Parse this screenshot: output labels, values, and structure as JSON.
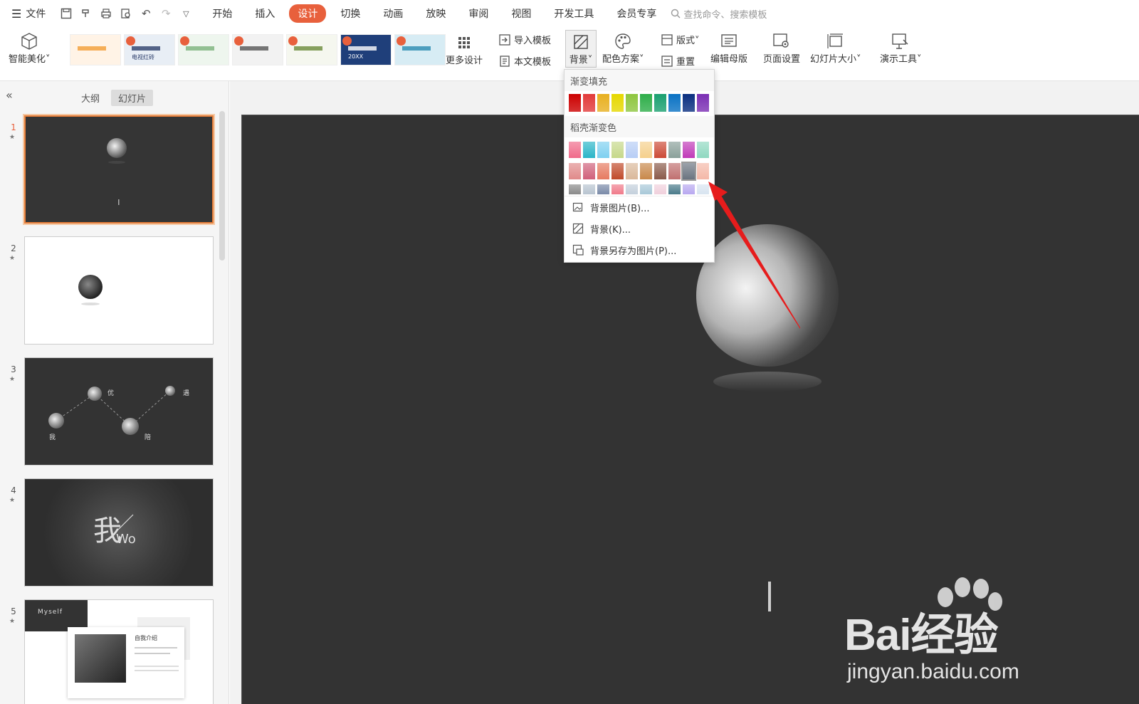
{
  "menubar": {
    "file_label": "文件",
    "tabs": [
      {
        "label": "开始",
        "active": false
      },
      {
        "label": "插入",
        "active": false
      },
      {
        "label": "设计",
        "active": true
      },
      {
        "label": "切换",
        "active": false
      },
      {
        "label": "动画",
        "active": false
      },
      {
        "label": "放映",
        "active": false
      },
      {
        "label": "审阅",
        "active": false
      },
      {
        "label": "视图",
        "active": false
      },
      {
        "label": "开发工具",
        "active": false
      },
      {
        "label": "会员专享",
        "active": false
      }
    ],
    "search_placeholder": "查找命令、搜索模板"
  },
  "ribbon": {
    "smart_beautify": "智能美化",
    "more_design": "更多设计",
    "import_template": "导入模板",
    "text_template": "本文模板",
    "background": "背景",
    "color_scheme": "配色方案",
    "layout": "版式",
    "reset": "重置",
    "edit_master": "编辑母版",
    "page_setup": "页面设置",
    "slide_size": "幻灯片大小",
    "presentation_tools": "演示工具",
    "template_thumbs": [
      {
        "text": "",
        "bg": "#fff3e6",
        "accent": "#f39c34"
      },
      {
        "text": "电视红砖",
        "bg": "#e8eef5",
        "accent": "#2c3e6b"
      },
      {
        "text": "",
        "bg": "#eef6ee",
        "accent": "#7bb37b"
      },
      {
        "text": "",
        "bg": "#f2f2f2",
        "accent": "#555555"
      },
      {
        "text": "",
        "bg": "#f5f7ef",
        "accent": "#6a8a3a"
      },
      {
        "text": "20XX",
        "bg": "#1f3f7a",
        "accent": "#ffffff"
      },
      {
        "text": "",
        "bg": "#d7ecf4",
        "accent": "#2a8bb0"
      }
    ]
  },
  "sidebar": {
    "tab_outline": "大纲",
    "tab_slides": "幻灯片",
    "slides": [
      {
        "num": "1",
        "theme": "dark"
      },
      {
        "num": "2",
        "theme": "light"
      },
      {
        "num": "3",
        "theme": "dark",
        "labels": [
          "优",
          "遇",
          "我",
          "陪"
        ]
      },
      {
        "num": "4",
        "theme": "dark",
        "big_text": "我",
        "sub_text": "Wo"
      },
      {
        "num": "5",
        "theme": "mixed",
        "header": "Myself",
        "title": "自我介绍"
      }
    ]
  },
  "dropdown": {
    "gradient_fill_title": "渐变填充",
    "gradient_colors": [
      "#cc0000",
      "#e23a3a",
      "#e8b020",
      "#e6d800",
      "#8ec63f",
      "#2fae4a",
      "#1aa070",
      "#0a72c4",
      "#0a2f80",
      "#7b2fb4"
    ],
    "daoke_title": "稻壳渐变色",
    "daoke_rows": [
      [
        "#f06a8a",
        "#2ab5c8",
        "#7ed0f0",
        "#c6d88a",
        "#b7cdf5",
        "#f5d08c",
        "#cc4a36",
        "#8aa09a",
        "#c03ab8",
        "#8fd8c0"
      ],
      [
        "#e08a8a",
        "#d0607a",
        "#e67a60",
        "#c04a2a",
        "#dab89a",
        "#c8884a",
        "#8a5a4a",
        "#c07070",
        "#6a7480",
        "#f4b8a8"
      ],
      [
        "#8a8a8a",
        "#b8c4d0",
        "#7a8aa8",
        "#f07a8a",
        "#c4d0dc",
        "#a8c8d8",
        "#f0d0dc",
        "#4a7a8a",
        "#b8a8f0",
        "#d8e4f0"
      ]
    ],
    "items": [
      {
        "label": "背景图片(B)...",
        "icon": "image-bg-icon"
      },
      {
        "label": "背景(K)...",
        "icon": "background-icon"
      },
      {
        "label": "背景另存为图片(P)...",
        "icon": "save-bg-icon"
      }
    ]
  },
  "watermark": {
    "brand": "Bai经验",
    "url": "jingyan.baidu.com"
  }
}
